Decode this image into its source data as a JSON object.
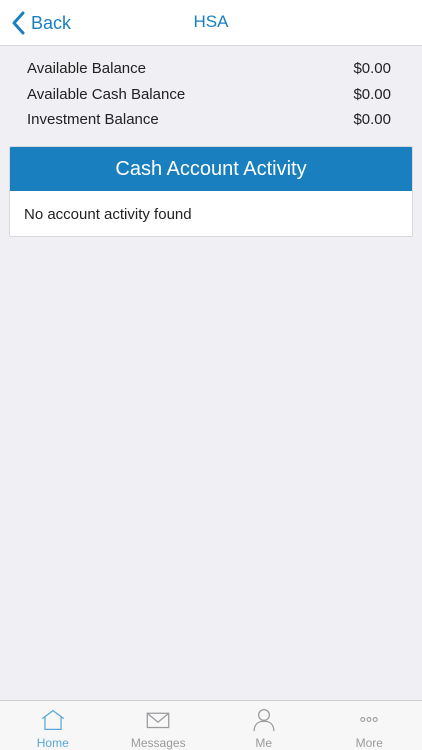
{
  "colors": {
    "accent": "#1a7fbf",
    "tab_active": "#5aa7d9",
    "tab_inactive": "#9a9a9e"
  },
  "nav": {
    "back_label": "Back",
    "title": "HSA",
    "back_icon": "chevron-left-icon"
  },
  "balances": [
    {
      "label": "Available Balance",
      "value": "$0.00"
    },
    {
      "label": "Available Cash Balance",
      "value": "$0.00"
    },
    {
      "label": "Investment Balance",
      "value": "$0.00"
    }
  ],
  "activity": {
    "title": "Cash Account Activity",
    "empty_message": "No account activity found"
  },
  "tabbar": {
    "items": [
      {
        "label": "Home",
        "icon": "home-icon",
        "active": true
      },
      {
        "label": "Messages",
        "icon": "envelope-icon",
        "active": false
      },
      {
        "label": "Me",
        "icon": "person-icon",
        "active": false
      },
      {
        "label": "More",
        "icon": "more-dots-icon",
        "active": false
      }
    ]
  }
}
